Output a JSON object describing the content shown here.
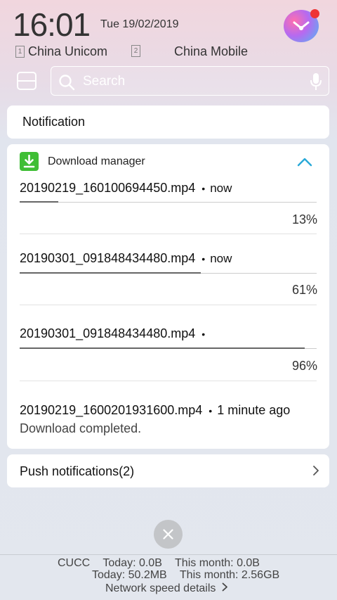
{
  "status_bar": {
    "time": "16:01",
    "date": "Tue 19/02/2019",
    "sim1_label": "1",
    "carrier1": "China Unicom",
    "sim2_label": "2",
    "carrier2": "China Mobile",
    "assistant_icon": "assistant-orb-icon"
  },
  "search": {
    "placeholder": "Search"
  },
  "notification_header": "Notification",
  "download_manager": {
    "title": "Download manager",
    "accent": "#3fbe35",
    "items": [
      {
        "filename": "20190219_160100694450.mp4",
        "separator": "•",
        "time": "now",
        "progress": 0.13,
        "percent": "13%"
      },
      {
        "filename": "20190301_091848434480.mp4",
        "separator": "•",
        "time": "now",
        "progress": 0.61,
        "percent": "61%"
      },
      {
        "filename": "20190301_091848434480.mp4",
        "separator": "•",
        "time": "",
        "progress": 0.96,
        "percent": "96%"
      },
      {
        "filename": "20190219_1600201931600.mp4",
        "separator": "•",
        "time": "1 minute ago",
        "status": "Download completed."
      }
    ]
  },
  "push_notifications": "Push notifications(2)",
  "data_usage": {
    "carrier1_short": "CUCC",
    "carrier1_today": "Today: 0.0B",
    "carrier1_month": "This month: 0.0B",
    "carrier2_today": "Today: 50.2MB",
    "carrier2_month": "This month: 2.56GB",
    "details_link": "Network speed details"
  },
  "colors": {
    "accent_blue": "#29a9d8",
    "progress": "#666666"
  }
}
